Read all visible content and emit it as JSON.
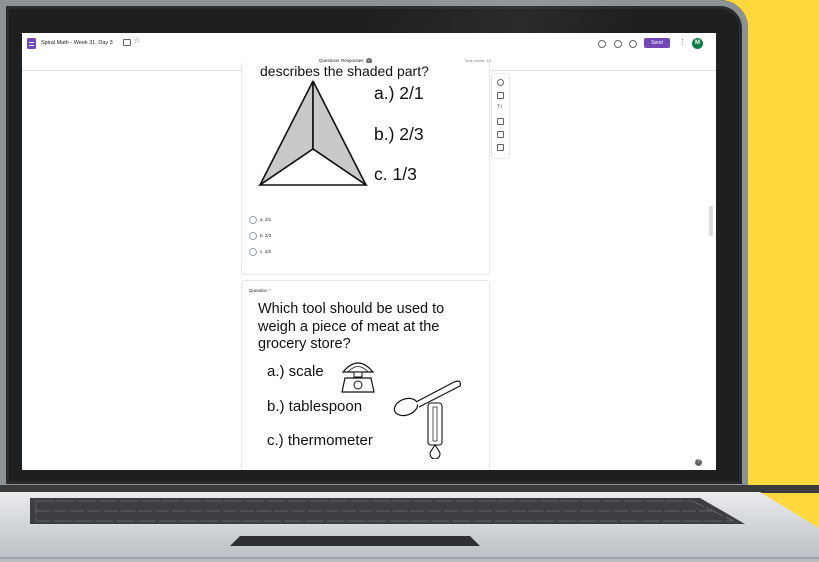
{
  "topbar": {
    "doc_title": "Spiral Math - Week 31, Day 3",
    "send_label": "Send",
    "avatar_initial": "M",
    "more_glyph": "⋮",
    "star_glyph": "☆"
  },
  "tabs": {
    "questions": "Questions",
    "responses": "Responses",
    "responses_count": "3",
    "total_points": "Total points: 15"
  },
  "question1": {
    "image_text": "describes the shaded part?",
    "image_choices": [
      "a.)  2/1",
      "b.)  2/3",
      "c.  1/3"
    ],
    "options": [
      "a. 2/1",
      "b. 2/3",
      "c. 1/3"
    ]
  },
  "question2": {
    "label": "Question",
    "required_mark": "*",
    "image_text": "Which tool should be used to weigh a piece of meat at the grocery store?",
    "image_choices": [
      "a.)  scale",
      "b.)  tablespoon",
      "c.)  thermometer"
    ]
  },
  "toolbar": {
    "text_tool_glyph": "Tт"
  },
  "help": {
    "glyph": "?"
  },
  "colors": {
    "background": "#FFD93B",
    "forms_purple": "#7248b9",
    "avatar_green": "#0b8043"
  },
  "icons": [
    "forms-logo-icon",
    "folder-icon",
    "star-icon",
    "palette-icon",
    "preview-eye-icon",
    "settings-icon",
    "add-question-icon",
    "import-questions-icon",
    "add-title-icon",
    "add-image-icon",
    "add-video-icon",
    "add-section-icon",
    "help-icon"
  ]
}
